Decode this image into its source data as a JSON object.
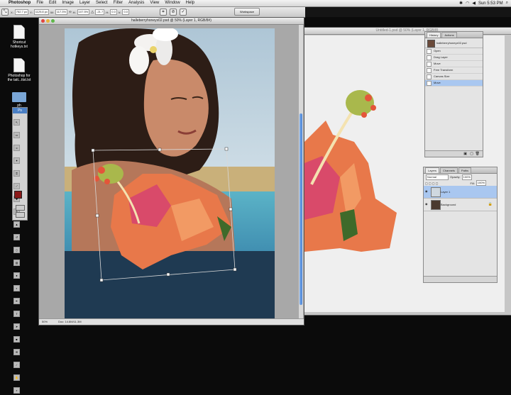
{
  "menubar": {
    "apple_glyph": "",
    "app_name": "Photoshop",
    "menus": [
      "File",
      "Edit",
      "Image",
      "Layer",
      "Select",
      "Filter",
      "Analysis",
      "View",
      "Window",
      "Help"
    ],
    "clock": "Sun 5:53 PM"
  },
  "options_bar": {
    "fields": [
      "752.7 px",
      "1129.8 px",
      "117.3%",
      "107.5%",
      "-21.7",
      "0.0",
      "0.0"
    ],
    "labels": [
      "X:",
      "Y:",
      "W:",
      "H:",
      "",
      "H:",
      "V:"
    ],
    "workspace_label": "Workspace"
  },
  "desktop": {
    "icons": [
      {
        "label_line1": "Shortcut",
        "label_line2": "hotkeys.txt"
      },
      {
        "label_line1": "Photoshop for",
        "label_line2": "the tatt...ttst.txt"
      },
      {
        "label_line1": "ph",
        "label_line2": ""
      }
    ]
  },
  "window1": {
    "title": "halleberryhoneyx02.psd @ 50% (Layer 1, RGB/8#)",
    "zoom": "50%",
    "doc_info": "Doc: 14.8M/11.3M"
  },
  "window2": {
    "title": "Untitled-1.psd @ 50% (Layer 1, RGB/8)"
  },
  "history_panel": {
    "tabs": [
      "History",
      "Actions"
    ],
    "snapshot": "halleberryhoneyx02.psd",
    "items": [
      "Open",
      "Drag Layer",
      "Move",
      "Free Transform",
      "Canvas Size",
      "Move"
    ],
    "selected_index": 5
  },
  "layers_panel": {
    "tabs": [
      "Layers",
      "Channels",
      "Paths"
    ],
    "blend_mode": "Normal",
    "opacity_label": "Opacity:",
    "opacity": "100%",
    "fill_label": "Fill:",
    "fill": "100%",
    "layers": [
      {
        "name": "Layer 1",
        "selected": true
      },
      {
        "name": "Background",
        "selected": false
      }
    ]
  },
  "colors": {
    "selection_blue": "#a9c7f0",
    "foreground_swatch": "#8b1a1a",
    "canvas_navy": "#1f3a52"
  }
}
